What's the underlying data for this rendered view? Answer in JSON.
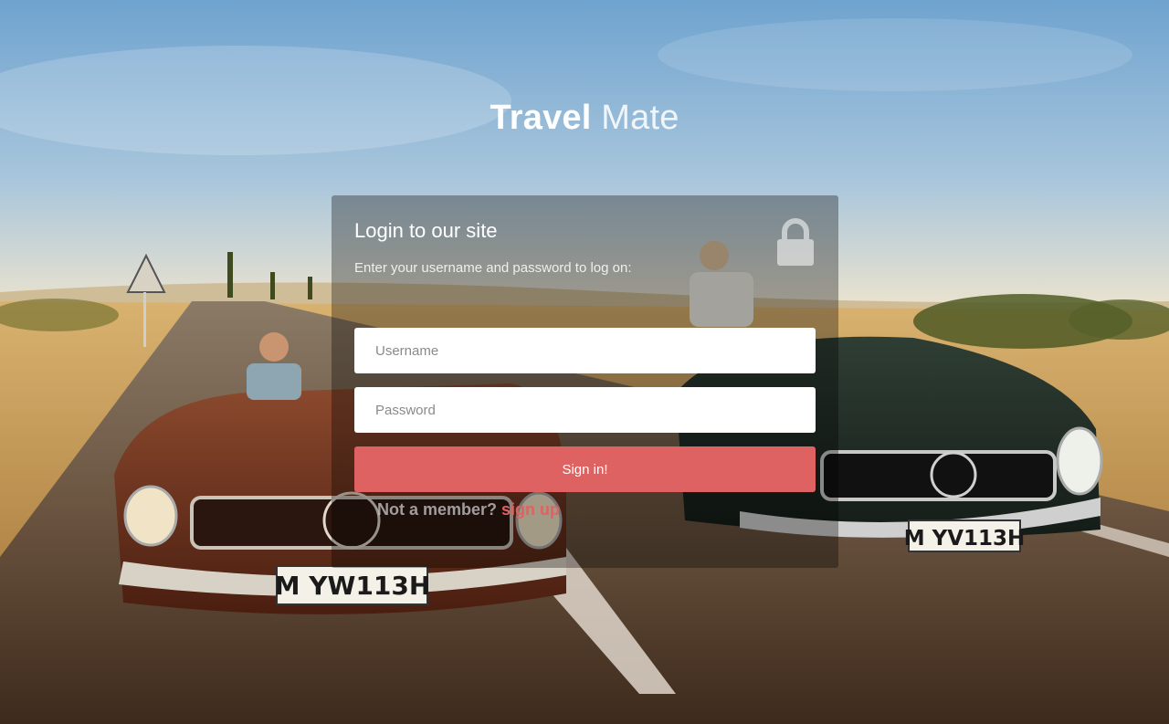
{
  "brand": {
    "bold": "Travel",
    "light": "Mate"
  },
  "login": {
    "title": "Login to our site",
    "subtitle": "Enter your username and password to log on:",
    "username_placeholder": "Username",
    "password_placeholder": "Password",
    "signin_label": "Sign in!",
    "member_text": "Not a member?",
    "signup_link": "sign up"
  },
  "icons": {
    "lock": "lock-icon"
  },
  "colors": {
    "accent": "#de6262",
    "panel": "rgba(0,0,0,0.32)"
  }
}
